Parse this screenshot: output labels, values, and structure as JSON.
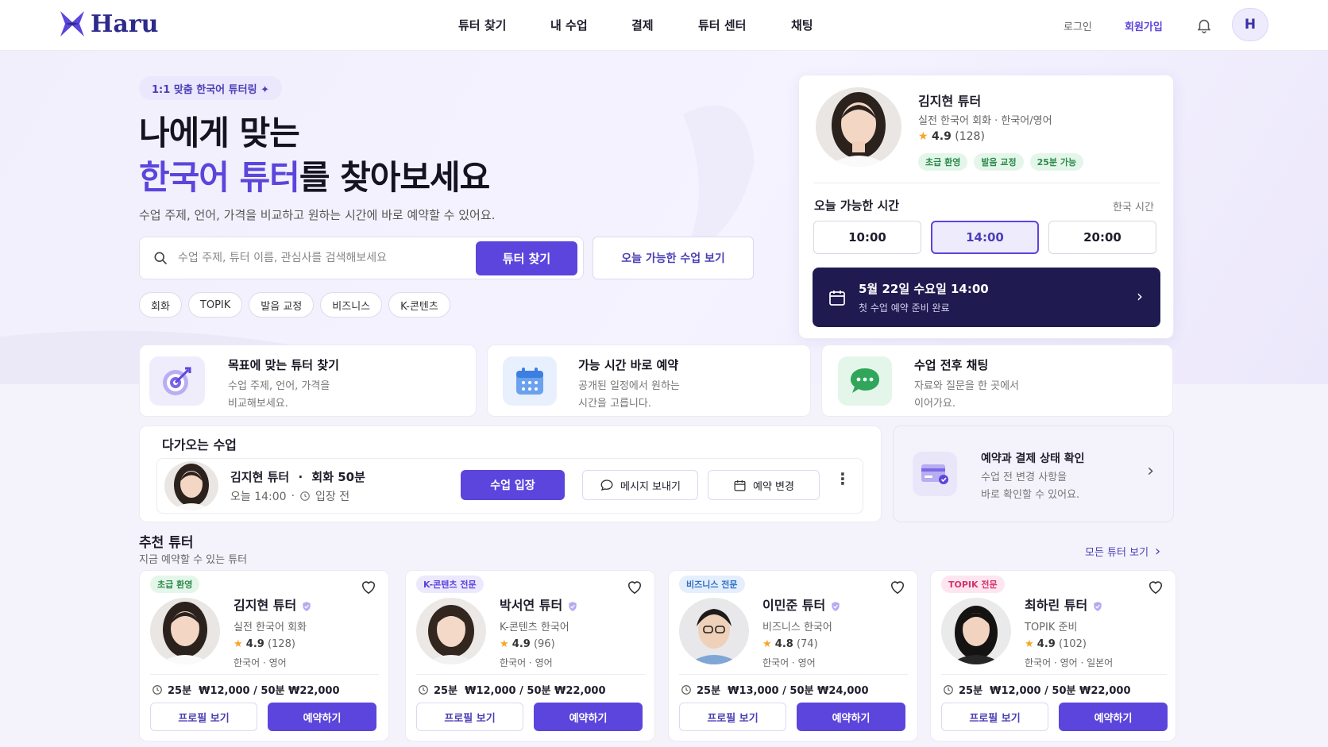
{
  "header": {
    "brand": "Haru",
    "nav": [
      "튜터 찾기",
      "내 수업",
      "결제",
      "튜터 센터",
      "채팅"
    ],
    "login": "로그인",
    "signup": "회원가입",
    "avatar_initial": "H",
    "colors": {
      "accent": "#5b45dc",
      "brand": "#2d2a8c"
    }
  },
  "hero": {
    "badge": "1:1 맞춤 한국어 튜터링 ✦",
    "title_line1": "나에게 맞는",
    "title_accent": "한국어 튜터",
    "title_rest": "를 찾아보세요",
    "subtitle": "수업 주제, 언어, 가격을 비교하고 원하는 시간에 바로 예약할 수 있어요.",
    "search_placeholder": "수업 주제, 튜터 이름, 관심사를 검색해보세요",
    "search_button": "튜터 찾기",
    "today_button": "오늘 가능한 수업 보기",
    "chips": [
      "회화",
      "TOPIK",
      "발음 교정",
      "비즈니스",
      "K-콘텐츠"
    ]
  },
  "featured": {
    "name": "김지현 튜터",
    "desc": "실전 한국어 회화 · 한국어/영어",
    "rating": "4.9",
    "reviews": "(128)",
    "tags": [
      "초급 환영",
      "발음 교정",
      "25분 가능"
    ],
    "avail_title": "오늘 가능한 시간",
    "tz": "한국 시간",
    "times": [
      "10:00",
      "14:00",
      "20:00"
    ],
    "selected_time": "14:00",
    "booking_title": "5월 22일 수요일 14:00",
    "booking_sub": "첫 수업 예약 준비 완료"
  },
  "features": [
    {
      "title": "목표에 맞는 튜터 찾기",
      "desc1": "수업 주제, 언어, 가격을",
      "desc2": "비교해보세요.",
      "icon": "target-icon"
    },
    {
      "title": "가능 시간 바로 예약",
      "desc1": "공개된 일정에서 원하는",
      "desc2": "시간을 고릅니다.",
      "icon": "calendar-icon"
    },
    {
      "title": "수업 전후 채팅",
      "desc1": "자료와 질문을 한 곳에서",
      "desc2": "이어가요.",
      "icon": "chat-icon"
    }
  ],
  "upcoming": {
    "title": "다가오는 수업",
    "tutor": "김지현 튜터",
    "sep": "·",
    "lesson": "회화 50분",
    "time": "오늘 14:00",
    "status": "입장 전",
    "enter": "수업 입장",
    "message": "메시지 보내기",
    "change": "예약 변경"
  },
  "booking_status": {
    "title": "예약과 결제 상태 확인",
    "desc1": "수업 전 변경 사항을",
    "desc2": "바로 확인할 수 있어요."
  },
  "recommended": {
    "title": "추천 튜터",
    "subtitle": "지금 예약할 수 있는 튜터",
    "all_link": "모든 튜터 보기",
    "profile_btn": "프로필 보기",
    "book_btn": "예약하기",
    "tutors": [
      {
        "tag": "초급 환영",
        "name": "김지현 튜터",
        "desc": "실전 한국어 회화",
        "rating": "4.9",
        "reviews": "(128)",
        "langs": "한국어 · 영어",
        "price": "25분  ₩12,000 / 50분 ₩22,000"
      },
      {
        "tag": "K-콘텐츠 전문",
        "name": "박서연 튜터",
        "desc": "K-콘텐츠 한국어",
        "rating": "4.9",
        "reviews": "(96)",
        "langs": "한국어 · 영어",
        "price": "25분  ₩12,000 / 50분 ₩22,000"
      },
      {
        "tag": "비즈니스 전문",
        "name": "이민준 튜터",
        "desc": "비즈니스 한국어",
        "rating": "4.8",
        "reviews": "(74)",
        "langs": "한국어 · 영어",
        "price": "25분  ₩13,000 / 50분 ₩24,000"
      },
      {
        "tag": "TOPIK 전문",
        "name": "최하린 튜터",
        "desc": "TOPIK 준비",
        "rating": "4.9",
        "reviews": "(102)",
        "langs": "한국어 · 영어 · 일본어",
        "price": "25분  ₩12,000 / 50분 ₩22,000"
      }
    ]
  }
}
